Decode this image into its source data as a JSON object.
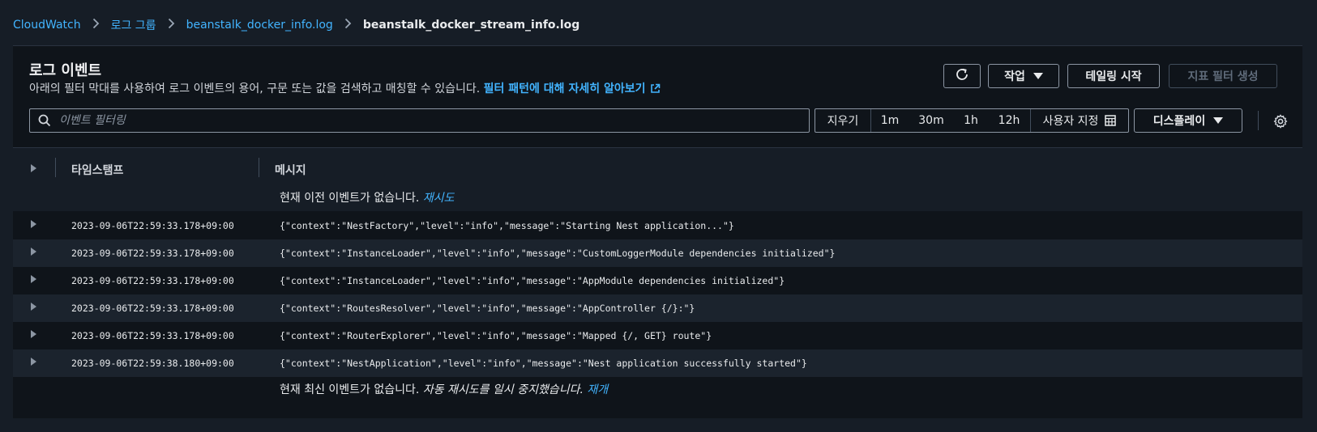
{
  "breadcrumb": {
    "items": [
      "CloudWatch",
      "로그 그룹",
      "beanstalk_docker_info.log"
    ],
    "current": "beanstalk_docker_stream_info.log"
  },
  "header": {
    "title": "로그 이벤트",
    "description": "아래의 필터 막대를 사용하여 로그 이벤트의 용어, 구문 또는 값을 검색하고 매칭할 수 있습니다.",
    "help_link": "필터 패턴에 대해 자세히 알아보기"
  },
  "toolbar": {
    "actions_label": "작업",
    "tail_label": "테일링 시작",
    "metric_filter_label": "지표 필터 생성"
  },
  "filter": {
    "placeholder": "이벤트 필터링",
    "clear_label": "지우기",
    "ranges": [
      "1m",
      "30m",
      "1h",
      "12h"
    ],
    "custom_label": "사용자 지정",
    "display_label": "디스플레이"
  },
  "table": {
    "col_timestamp": "타임스탬프",
    "col_message": "메시지",
    "older_text": "현재 이전 이벤트가 없습니다.",
    "retry_label": "재시도",
    "newer_text": "현재 최신 이벤트가 없습니다.",
    "paused_text": "자동 재시도를 일시 중지했습니다.",
    "resume_label": "재개",
    "rows": [
      {
        "ts": "2023-09-06T22:59:33.178+09:00",
        "msg": "{\"context\":\"NestFactory\",\"level\":\"info\",\"message\":\"Starting Nest application...\"}"
      },
      {
        "ts": "2023-09-06T22:59:33.178+09:00",
        "msg": "{\"context\":\"InstanceLoader\",\"level\":\"info\",\"message\":\"CustomLoggerModule dependencies initialized\"}"
      },
      {
        "ts": "2023-09-06T22:59:33.178+09:00",
        "msg": "{\"context\":\"InstanceLoader\",\"level\":\"info\",\"message\":\"AppModule dependencies initialized\"}"
      },
      {
        "ts": "2023-09-06T22:59:33.178+09:00",
        "msg": "{\"context\":\"RoutesResolver\",\"level\":\"info\",\"message\":\"AppController {/}:\"}"
      },
      {
        "ts": "2023-09-06T22:59:33.178+09:00",
        "msg": "{\"context\":\"RouterExplorer\",\"level\":\"info\",\"message\":\"Mapped {/, GET} route\"}"
      },
      {
        "ts": "2023-09-06T22:59:38.180+09:00",
        "msg": "{\"context\":\"NestApplication\",\"level\":\"info\",\"message\":\"Nest application successfully started\"}"
      }
    ]
  },
  "colors": {
    "accent": "#42b4ff",
    "background": "#161d26",
    "panel": "#0f141a",
    "row_alt": "#1b232d"
  },
  "icons": [
    "chevron-right-icon",
    "external-link-icon",
    "refresh-icon",
    "caret-down-icon",
    "search-icon",
    "calendar-icon",
    "gear-icon",
    "expand-triangle-icon"
  ]
}
